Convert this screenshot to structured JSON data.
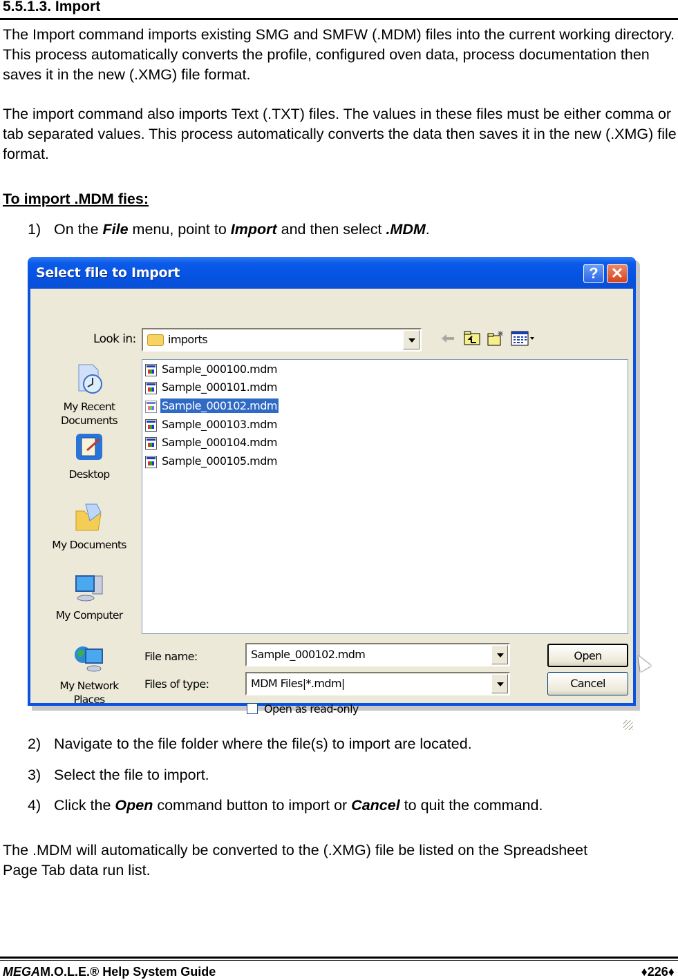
{
  "section": {
    "title": "5.5.1.3. Import",
    "para1": "The Import command imports existing SMG and SMFW (.MDM) files into the current working directory. This process automatically converts the profile, configured oven data, process documentation then saves it in the new (.XMG) file format.",
    "para2": "The import command also imports Text (.TXT) files. The values in these files must be either comma or tab separated values. This process automatically converts the data then saves it in the new (.XMG) file format.",
    "subheading": "To import .MDM fies:",
    "steps": [
      {
        "num": "1)",
        "parts": [
          "On the ",
          "File",
          " menu, point to ",
          "Import",
          " and then select ",
          ".MDM",
          "."
        ]
      },
      {
        "num": "2)",
        "text": "Navigate to the file folder where the file(s) to import are located."
      },
      {
        "num": "3)",
        "text": "Select the file to import."
      },
      {
        "num": "4)",
        "parts": [
          "Click the ",
          "Open",
          " command button to import or ",
          "Cancel",
          " to quit the command."
        ]
      }
    ],
    "closing": "The .MDM will automatically be converted to the (.XMG) file be listed on the Spreadsheet Page Tab data run list."
  },
  "dialog": {
    "title": "Select file to Import",
    "help_glyph": "?",
    "close_glyph": "✕",
    "look_in_label": "Look in:",
    "look_in_value": "imports",
    "places": [
      "My Recent Documents",
      "Desktop",
      "My Documents",
      "My Computer",
      "My Network Places"
    ],
    "files": [
      {
        "name": "Sample_000100.mdm",
        "selected": false
      },
      {
        "name": "Sample_000101.mdm",
        "selected": false
      },
      {
        "name": "Sample_000102.mdm",
        "selected": true
      },
      {
        "name": "Sample_000103.mdm",
        "selected": false
      },
      {
        "name": "Sample_000104.mdm",
        "selected": false
      },
      {
        "name": "Sample_000105.mdm",
        "selected": false
      }
    ],
    "file_name_label": "File name:",
    "file_name_value": "Sample_000102.mdm",
    "file_type_label": "Files of type:",
    "file_type_value": "MDM Files|*.mdm|",
    "read_only_label": "Open as read-only",
    "read_only_checked": false,
    "open_label": "Open",
    "cancel_label": "Cancel",
    "colors": {
      "titlebar": "#0553e2",
      "body": "#ece9d8",
      "selection": "#316ac5"
    }
  },
  "footer": {
    "left_italic": "MEGA",
    "left_rest": "M.O.L.E.® Help System Guide",
    "page": "♦226♦"
  }
}
